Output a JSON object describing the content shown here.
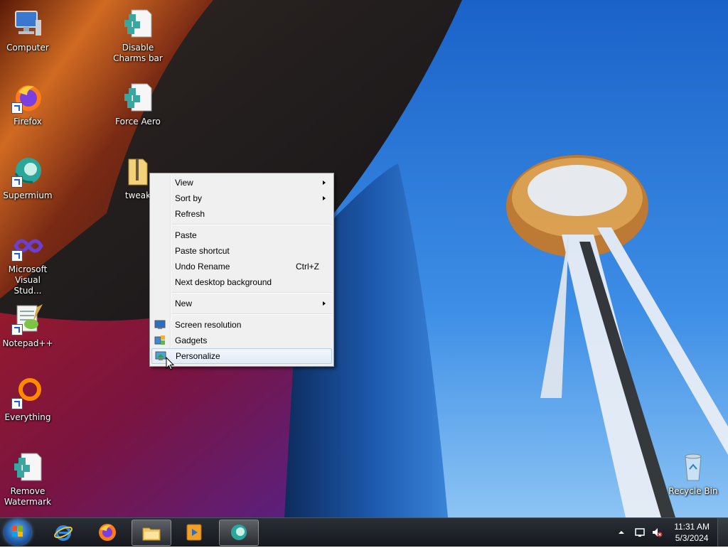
{
  "desktop_icons": [
    {
      "label": "Computer"
    },
    {
      "label": "Firefox"
    },
    {
      "label": "Supermium"
    },
    {
      "label": "Microsoft Visual Stud..."
    },
    {
      "label": "Notepad++"
    },
    {
      "label": "Everything"
    },
    {
      "label": "Remove Watermark"
    },
    {
      "label": "Disable Charms bar"
    },
    {
      "label": "Force Aero"
    },
    {
      "label": "tweak"
    },
    {
      "label": "Recycle Bin"
    }
  ],
  "context_menu": {
    "items": [
      {
        "label": "View"
      },
      {
        "label": "Sort by"
      },
      {
        "label": "Refresh"
      },
      {
        "label": "Paste"
      },
      {
        "label": "Paste shortcut"
      },
      {
        "label": "Undo Rename",
        "accel": "Ctrl+Z"
      },
      {
        "label": "Next desktop background"
      },
      {
        "label": "New"
      },
      {
        "label": "Screen resolution"
      },
      {
        "label": "Gadgets"
      },
      {
        "label": "Personalize"
      }
    ],
    "hovered": "Personalize"
  },
  "taskbar": {
    "pinned": [
      "start-button",
      "internet-explorer",
      "firefox",
      "file-explorer",
      "media-player",
      "supermium"
    ],
    "clock_time": "11:31 AM",
    "clock_date": "5/3/2024"
  },
  "colors": {
    "menu_bg": "#f0f0f0",
    "menu_hover_border": "#aecff7",
    "taskbar_bg": "#15181d"
  }
}
